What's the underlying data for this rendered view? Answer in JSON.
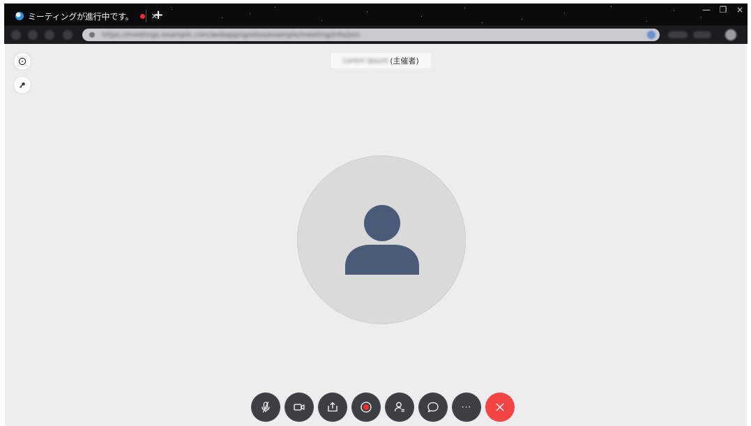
{
  "browser": {
    "tab_title": "ミーティングが進行中です。",
    "tab_close": "×",
    "new_tab": "+",
    "url": "https://meetings.example.com/webappng/sites/example/meeting/info/join",
    "window_controls": {
      "minimize": "—",
      "restore": "❐",
      "close": "×"
    }
  },
  "meeting": {
    "host_name": "Lorem Ipsum",
    "host_role": "(主催者)",
    "info_icon": "info-icon",
    "key_icon": "key-icon",
    "avatar": "default-user-avatar"
  },
  "controls": [
    {
      "name": "mute-button",
      "icon": "microphone-muted-icon"
    },
    {
      "name": "video-button",
      "icon": "video-camera-icon"
    },
    {
      "name": "share-button",
      "icon": "share-screen-icon"
    },
    {
      "name": "record-button",
      "icon": "record-icon"
    },
    {
      "name": "participants-button",
      "icon": "participants-icon"
    },
    {
      "name": "chat-button",
      "icon": "chat-bubble-icon"
    },
    {
      "name": "more-button",
      "icon": "more-options-icon",
      "label": "···"
    },
    {
      "name": "end-call-button",
      "icon": "close-icon",
      "label": "×"
    }
  ],
  "colors": {
    "background": "#ededf0",
    "avatar_fill": "#4a5a78",
    "control_bg": "#3e3f44",
    "end_call": "#f34545",
    "record_dot": "#ff2d2d"
  }
}
